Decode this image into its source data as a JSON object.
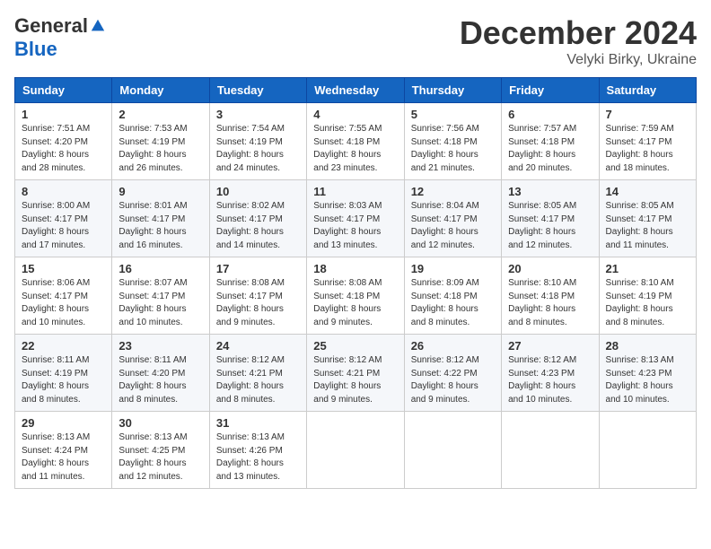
{
  "logo": {
    "general": "General",
    "blue": "Blue"
  },
  "title": "December 2024",
  "location": "Velyki Birky, Ukraine",
  "days_of_week": [
    "Sunday",
    "Monday",
    "Tuesday",
    "Wednesday",
    "Thursday",
    "Friday",
    "Saturday"
  ],
  "weeks": [
    [
      {
        "day": "1",
        "info": "Sunrise: 7:51 AM\nSunset: 4:20 PM\nDaylight: 8 hours\nand 28 minutes."
      },
      {
        "day": "2",
        "info": "Sunrise: 7:53 AM\nSunset: 4:19 PM\nDaylight: 8 hours\nand 26 minutes."
      },
      {
        "day": "3",
        "info": "Sunrise: 7:54 AM\nSunset: 4:19 PM\nDaylight: 8 hours\nand 24 minutes."
      },
      {
        "day": "4",
        "info": "Sunrise: 7:55 AM\nSunset: 4:18 PM\nDaylight: 8 hours\nand 23 minutes."
      },
      {
        "day": "5",
        "info": "Sunrise: 7:56 AM\nSunset: 4:18 PM\nDaylight: 8 hours\nand 21 minutes."
      },
      {
        "day": "6",
        "info": "Sunrise: 7:57 AM\nSunset: 4:18 PM\nDaylight: 8 hours\nand 20 minutes."
      },
      {
        "day": "7",
        "info": "Sunrise: 7:59 AM\nSunset: 4:17 PM\nDaylight: 8 hours\nand 18 minutes."
      }
    ],
    [
      {
        "day": "8",
        "info": "Sunrise: 8:00 AM\nSunset: 4:17 PM\nDaylight: 8 hours\nand 17 minutes."
      },
      {
        "day": "9",
        "info": "Sunrise: 8:01 AM\nSunset: 4:17 PM\nDaylight: 8 hours\nand 16 minutes."
      },
      {
        "day": "10",
        "info": "Sunrise: 8:02 AM\nSunset: 4:17 PM\nDaylight: 8 hours\nand 14 minutes."
      },
      {
        "day": "11",
        "info": "Sunrise: 8:03 AM\nSunset: 4:17 PM\nDaylight: 8 hours\nand 13 minutes."
      },
      {
        "day": "12",
        "info": "Sunrise: 8:04 AM\nSunset: 4:17 PM\nDaylight: 8 hours\nand 12 minutes."
      },
      {
        "day": "13",
        "info": "Sunrise: 8:05 AM\nSunset: 4:17 PM\nDaylight: 8 hours\nand 12 minutes."
      },
      {
        "day": "14",
        "info": "Sunrise: 8:05 AM\nSunset: 4:17 PM\nDaylight: 8 hours\nand 11 minutes."
      }
    ],
    [
      {
        "day": "15",
        "info": "Sunrise: 8:06 AM\nSunset: 4:17 PM\nDaylight: 8 hours\nand 10 minutes."
      },
      {
        "day": "16",
        "info": "Sunrise: 8:07 AM\nSunset: 4:17 PM\nDaylight: 8 hours\nand 10 minutes."
      },
      {
        "day": "17",
        "info": "Sunrise: 8:08 AM\nSunset: 4:17 PM\nDaylight: 8 hours\nand 9 minutes."
      },
      {
        "day": "18",
        "info": "Sunrise: 8:08 AM\nSunset: 4:18 PM\nDaylight: 8 hours\nand 9 minutes."
      },
      {
        "day": "19",
        "info": "Sunrise: 8:09 AM\nSunset: 4:18 PM\nDaylight: 8 hours\nand 8 minutes."
      },
      {
        "day": "20",
        "info": "Sunrise: 8:10 AM\nSunset: 4:18 PM\nDaylight: 8 hours\nand 8 minutes."
      },
      {
        "day": "21",
        "info": "Sunrise: 8:10 AM\nSunset: 4:19 PM\nDaylight: 8 hours\nand 8 minutes."
      }
    ],
    [
      {
        "day": "22",
        "info": "Sunrise: 8:11 AM\nSunset: 4:19 PM\nDaylight: 8 hours\nand 8 minutes."
      },
      {
        "day": "23",
        "info": "Sunrise: 8:11 AM\nSunset: 4:20 PM\nDaylight: 8 hours\nand 8 minutes."
      },
      {
        "day": "24",
        "info": "Sunrise: 8:12 AM\nSunset: 4:21 PM\nDaylight: 8 hours\nand 8 minutes."
      },
      {
        "day": "25",
        "info": "Sunrise: 8:12 AM\nSunset: 4:21 PM\nDaylight: 8 hours\nand 9 minutes."
      },
      {
        "day": "26",
        "info": "Sunrise: 8:12 AM\nSunset: 4:22 PM\nDaylight: 8 hours\nand 9 minutes."
      },
      {
        "day": "27",
        "info": "Sunrise: 8:12 AM\nSunset: 4:23 PM\nDaylight: 8 hours\nand 10 minutes."
      },
      {
        "day": "28",
        "info": "Sunrise: 8:13 AM\nSunset: 4:23 PM\nDaylight: 8 hours\nand 10 minutes."
      }
    ],
    [
      {
        "day": "29",
        "info": "Sunrise: 8:13 AM\nSunset: 4:24 PM\nDaylight: 8 hours\nand 11 minutes."
      },
      {
        "day": "30",
        "info": "Sunrise: 8:13 AM\nSunset: 4:25 PM\nDaylight: 8 hours\nand 12 minutes."
      },
      {
        "day": "31",
        "info": "Sunrise: 8:13 AM\nSunset: 4:26 PM\nDaylight: 8 hours\nand 13 minutes."
      },
      null,
      null,
      null,
      null
    ]
  ]
}
